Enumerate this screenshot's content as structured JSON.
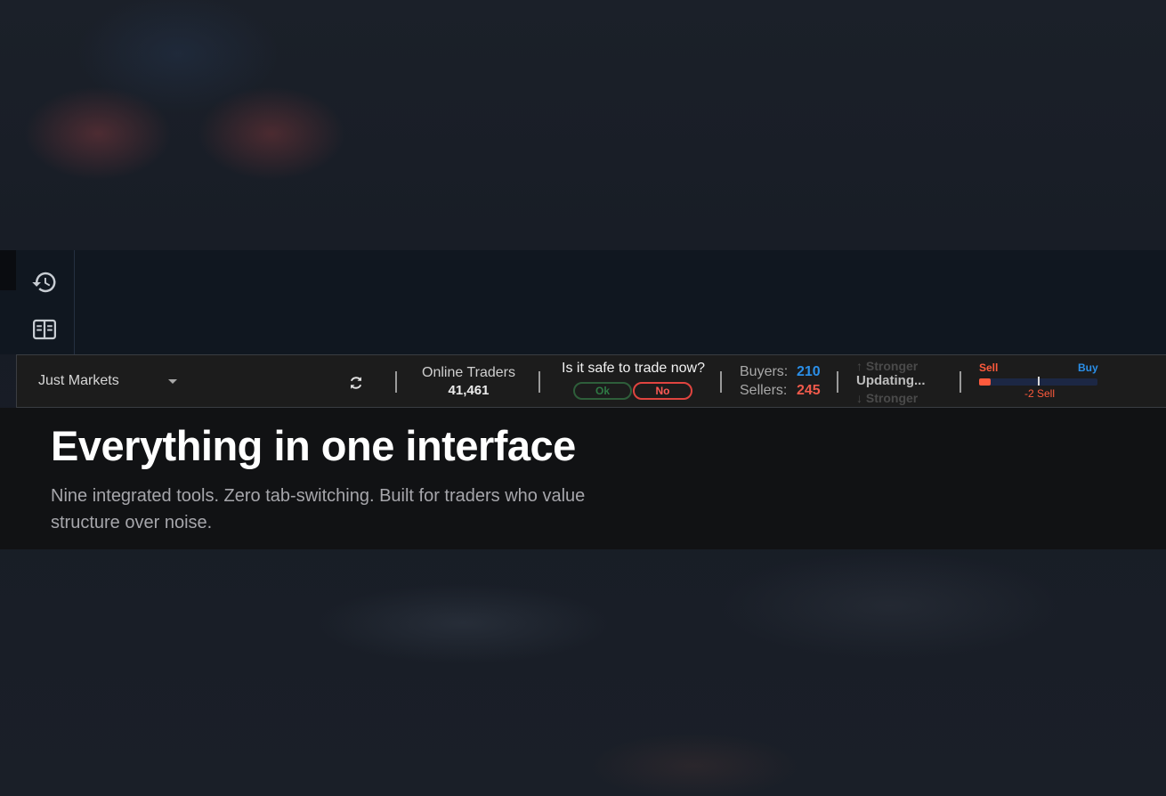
{
  "toolbar": {
    "market_selector": "Just Markets",
    "online_traders_label": "Online Traders",
    "online_traders_count": "41,461",
    "safe_question": "Is it safe to trade now?",
    "ok_label": "Ok",
    "no_label": "No",
    "buyers_label": "Buyers:",
    "buyers_value": "210",
    "sellers_label": "Sellers:",
    "sellers_value": "245",
    "stronger_up": "↑ Stronger",
    "updating": "Updating...",
    "stronger_down": "↓ Stronger",
    "sentiment_sell_label": "Sell",
    "sentiment_buy_label": "Buy",
    "sentiment_value_text": "-2 Sell",
    "sentiment_sell_fill_fraction": 0.1
  },
  "hero": {
    "title": "Everything in one interface",
    "subtitle": "Nine integrated tools. Zero tab-switching. Built for traders who value structure over noise."
  },
  "icons": {
    "rail": [
      "history-icon",
      "book-icon"
    ],
    "toolbar": [
      "chevron-down-icon",
      "refresh-icon"
    ]
  },
  "colors": {
    "buy_blue": "#2b8fe8",
    "sell_red": "#f05a4b",
    "ok_green": "#2e7a44",
    "no_red": "#e0443f"
  }
}
